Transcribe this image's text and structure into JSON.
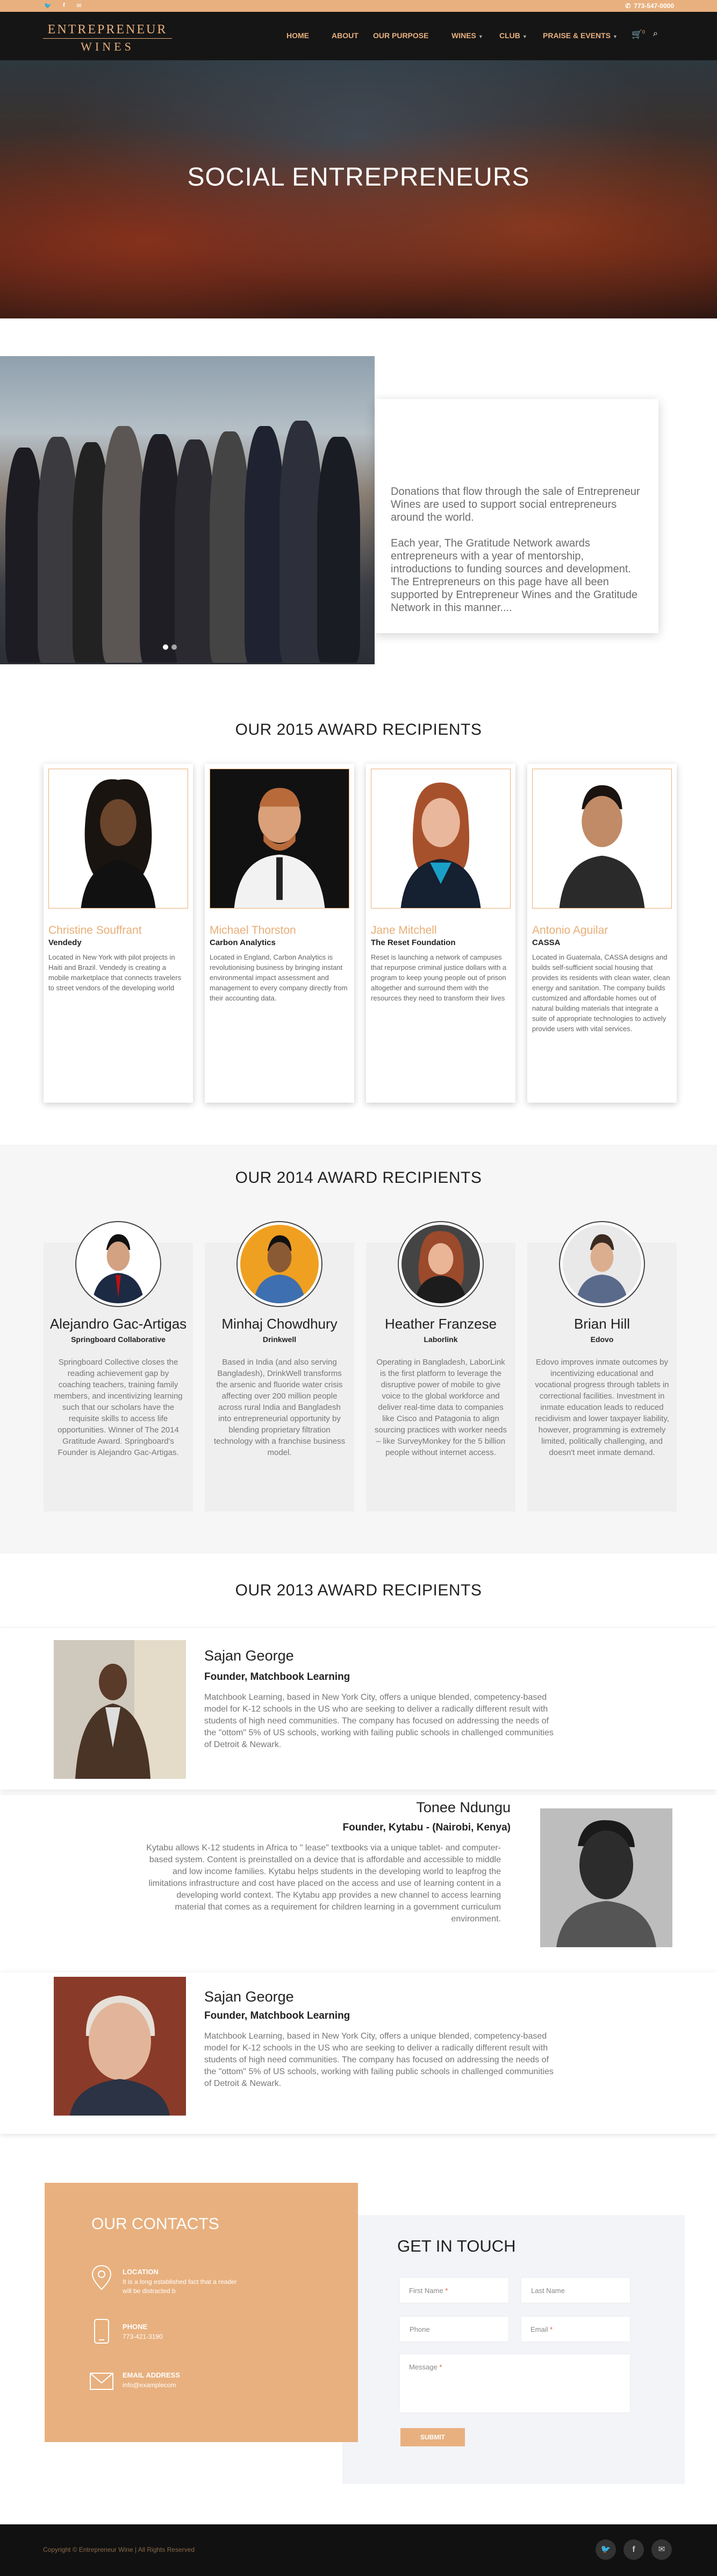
{
  "topbar": {
    "social": [
      {
        "icon": "twitter-icon",
        "glyph": "🐦"
      },
      {
        "icon": "facebook-icon",
        "glyph": "f"
      },
      {
        "icon": "mail-icon",
        "glyph": "✉"
      }
    ],
    "phone": "773-547-0000"
  },
  "nav": {
    "logo_line1": "ENTREPRENEUR",
    "logo_line2": "WINES",
    "items": [
      "HOME",
      "ABOUT",
      "OUR PURPOSE",
      "WINES",
      "CLUB",
      "PRAISE & EVENTS"
    ],
    "cart_count": "0"
  },
  "hero": {
    "title": "SOCIAL ENTREPRENEURS"
  },
  "intro": {
    "p1": "Donations that flow through the sale of Entrepreneur Wines are used to support social entrepreneurs around the world.",
    "p2": "Each year, The Gratitude Network awards entrepreneurs with a year of mentorship, introductions to funding sources and development. The Entrepreneurs on this page have all been supported by Entrepreneur Wines and the Gratitude Network in this manner...."
  },
  "awards2015": {
    "heading": "OUR 2015 AWARD RECIPIENTS",
    "people": [
      {
        "name": "Christine Souffrant",
        "org": "Vendedy",
        "desc": "Located in New York with pilot projects in Haiti and Brazil. Vendedy is creating a mobile marketplace that connects travelers to street vendors of the developing world"
      },
      {
        "name": "Michael Thorston",
        "org": "Carbon Analytics",
        "desc": "Located in England, Carbon Analytics is revolutionising business by bringing instant environmental impact assessment and management to every company directly from their accounting data."
      },
      {
        "name": "Jane Mitchell",
        "org": "The Reset Foundation",
        "desc": "Reset is launching a network of campuses that repurpose criminal justice dollars with a program to keep young people out of prison altogether and surround them with the resources they need to transform their lives"
      },
      {
        "name": "Antonio Aguilar",
        "org": "CASSA",
        "desc": "Located in Guatemala, CASSA designs and builds self-sufficient social housing that provides its residents with clean water, clean energy and sanitation. The company builds customized and affordable homes out of natural building materials that integrate a suite of appropriate technologies to actively provide users with vital services."
      }
    ]
  },
  "awards2014": {
    "heading": "OUR 2014 AWARD RECIPIENTS",
    "people": [
      {
        "name": "Alejandro Gac-Artigas",
        "org": "Springboard Collaborative",
        "desc": "Springboard Collective closes the reading achievement gap by coaching teachers, training family members, and incentivizing learning such that our scholars have the requisite skills to access life opportunities. Winner of The 2014 Gratitude Award. Springboard's Founder is Alejandro Gac-Artigas."
      },
      {
        "name": "Minhaj Chowdhury",
        "org": "Drinkwell",
        "desc": "Based in India (and also serving Bangladesh), DrinkWell transforms the arsenic and fluoride water crisis affecting over 200 million people across rural India and Bangladesh into entrepreneurial opportunity by blending proprietary filtration technology with a franchise business model."
      },
      {
        "name": "Heather Franzese",
        "org": "Laborlink",
        "desc": "Operating in Bangladesh, LaborLink is the first platform to leverage the disruptive power of mobile to give voice to the global workforce and deliver real-time data to companies like Cisco and Patagonia to align sourcing practices with worker needs – like SurveyMonkey for the 5 billion people without internet access."
      },
      {
        "name": "Brian Hill",
        "org": "Edovo",
        "desc": "Edovo improves inmate outcomes by incentivizing educational and vocational progress through tablets in correctional facilities. Investment in inmate education leads to reduced recidivism and lower taxpayer liability, however, programming is extremely limited, politically challenging, and doesn't meet inmate demand."
      }
    ]
  },
  "awards2013": {
    "heading": "OUR 2013 AWARD RECIPIENTS",
    "people": [
      {
        "name": "Sajan George",
        "role": "Founder, Matchbook Learning",
        "desc": "Matchbook Learning, based in New York City, offers a unique blended, competency-based model for K-12 schools in the US who are seeking to deliver a radically different result with students of high need communities. The company has focused on addressing the needs of the \"ottom\" 5% of US schools, working with failing public schools in challenged communities of Detroit & Newark."
      },
      {
        "name": "Tonee Ndungu",
        "role": "Founder, Kytabu - (Nairobi, Kenya)",
        "desc": "Kytabu allows K-12 students in Africa to \" lease\" textbooks via a unique tablet- and computer-based system. Content is preinstalled on a device that is affordable and accessible to middle and low income families. Kytabu helps students in the developing world to leapfrog the limitations infrastructure and cost have placed on the access and use of learning content in a developing world context. The Kytabu app provides a new channel to access learning material that comes as a requirement for children learning in a government curriculum environment."
      },
      {
        "name": "Sajan George",
        "role": "Founder, Matchbook Learning",
        "desc": "Matchbook Learning, based in New York City, offers a unique blended, competency-based model for K-12 schools in the US who are seeking to deliver a radically different result with students of high need communities. The company has focused on addressing the needs of the \"ottom\" 5% of US schools, working with failing public schools in challenged communities of Detroit & Newark."
      }
    ]
  },
  "contacts": {
    "heading": "OUR CONTACTS",
    "location_label": "LOCATION",
    "location_value": "It is a long established fact that a reader will be distracted b",
    "phone_label": "PHONE",
    "phone_value": "773-421-3190",
    "email_label": "EMAIL ADDRESS",
    "email_value": "info@examplecom"
  },
  "form": {
    "heading": "GET IN TOUCH",
    "first_name": "First Name",
    "last_name": "Last Name",
    "phone": "Phone",
    "email": "Email",
    "message": "Message",
    "required_mark": "*",
    "submit": "SUBMIT"
  },
  "footer": {
    "copyright": "Copyright © Entrepreneur Wine | All Rights Reserved",
    "social": [
      {
        "icon": "twitter-icon",
        "glyph": "🐦"
      },
      {
        "icon": "facebook-icon",
        "glyph": "f"
      },
      {
        "icon": "mail-icon",
        "glyph": "✉"
      }
    ]
  },
  "colors": {
    "accent": "#e8b07e",
    "dark": "#151515",
    "text": "#555555"
  }
}
